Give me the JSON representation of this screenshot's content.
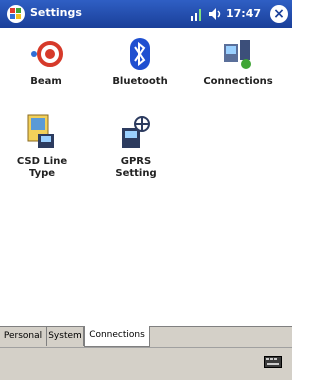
{
  "window": {
    "title": "Settings",
    "time": "17:47"
  },
  "icons": {
    "start": "windows-flag-icon",
    "signal": "signal-icon",
    "volume": "volume-icon",
    "close": "close-icon",
    "keyboard": "keyboard-icon"
  },
  "items": [
    {
      "label": "Beam",
      "icon": "beam-icon"
    },
    {
      "label": "Bluetooth",
      "icon": "bluetooth-icon"
    },
    {
      "label": "Connections",
      "icon": "connections-icon"
    },
    {
      "label": "CSD Line Type",
      "icon": "csd-line-type-icon"
    },
    {
      "label": "GPRS Setting",
      "icon": "gprs-setting-icon"
    }
  ],
  "tabs": [
    {
      "label": "Personal"
    },
    {
      "label": "System"
    },
    {
      "label": "Connections",
      "active": true
    }
  ],
  "colors": {
    "titlebar": "#1f4fb0",
    "tab_bg": "#d4d0c8"
  }
}
